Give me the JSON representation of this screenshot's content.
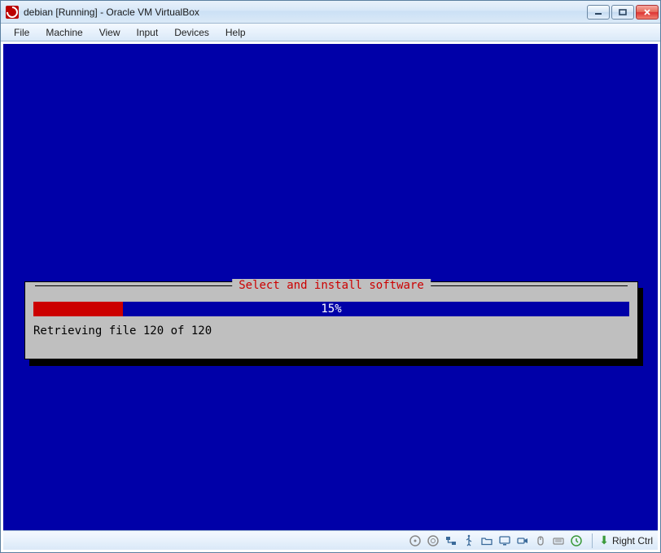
{
  "window": {
    "title": "debian [Running] - Oracle VM VirtualBox"
  },
  "menu": {
    "file": "File",
    "machine": "Machine",
    "view": "View",
    "input": "Input",
    "devices": "Devices",
    "help": "Help"
  },
  "installer": {
    "dialog_title": "Select and install software",
    "progress_percent": 15,
    "progress_label": "15%",
    "status": "Retrieving file 120 of 120"
  },
  "statusbar": {
    "host_key": "Right Ctrl"
  },
  "colors": {
    "guest_bg": "#0000a8",
    "dialog_bg": "#bfbfbf",
    "accent_red": "#c00"
  }
}
